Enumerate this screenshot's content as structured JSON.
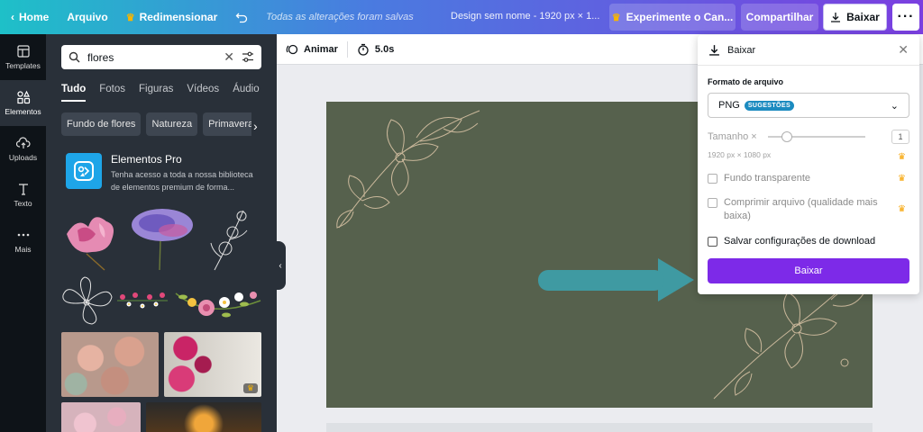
{
  "topbar": {
    "home": "Home",
    "file": "Arquivo",
    "resize": "Redimensionar",
    "saved": "Todas as alterações foram salvas",
    "title": "Design sem nome - 1920 px × 1...",
    "try_pro": "Experimente o Can...",
    "share": "Compartilhar",
    "download": "Baixar",
    "more": "···"
  },
  "rail": {
    "items": [
      {
        "label": "Templates",
        "icon": "layout-icon"
      },
      {
        "label": "Elementos",
        "icon": "shapes-icon"
      },
      {
        "label": "Uploads",
        "icon": "cloud-upload-icon"
      },
      {
        "label": "Texto",
        "icon": "text-icon"
      },
      {
        "label": "Mais",
        "icon": "more-icon"
      }
    ]
  },
  "panel": {
    "search_value": "flores",
    "tabs": [
      "Tudo",
      "Fotos",
      "Figuras",
      "Vídeos",
      "Áudio"
    ],
    "chips": [
      "Fundo de flores",
      "Natureza",
      "Primavera"
    ],
    "pro_title": "Elementos Pro",
    "pro_desc": "Tenha acesso a toda a nossa biblioteca de elementos premium de forma..."
  },
  "editor": {
    "animate": "Animar",
    "duration": "5.0s"
  },
  "download_popover": {
    "title": "Baixar",
    "format_label": "Formato de arquivo",
    "format_value": "PNG",
    "format_badge": "SUGESTÕES",
    "size_label": "Tamanho ×",
    "size_value": "1",
    "size_fraction": 0.2,
    "dims": "1920 px × 1080 px",
    "option_transparent": "Fundo transparente",
    "option_compress": "Comprimir arquivo (qualidade mais baixa)",
    "option_save": "Salvar configurações de download",
    "button": "Baixar"
  },
  "colors": {
    "accent": "#7d2ae8",
    "canvas": "#56614d",
    "arrow": "#3f9aa2",
    "panel": "#293039",
    "rail": "#0e1318"
  }
}
